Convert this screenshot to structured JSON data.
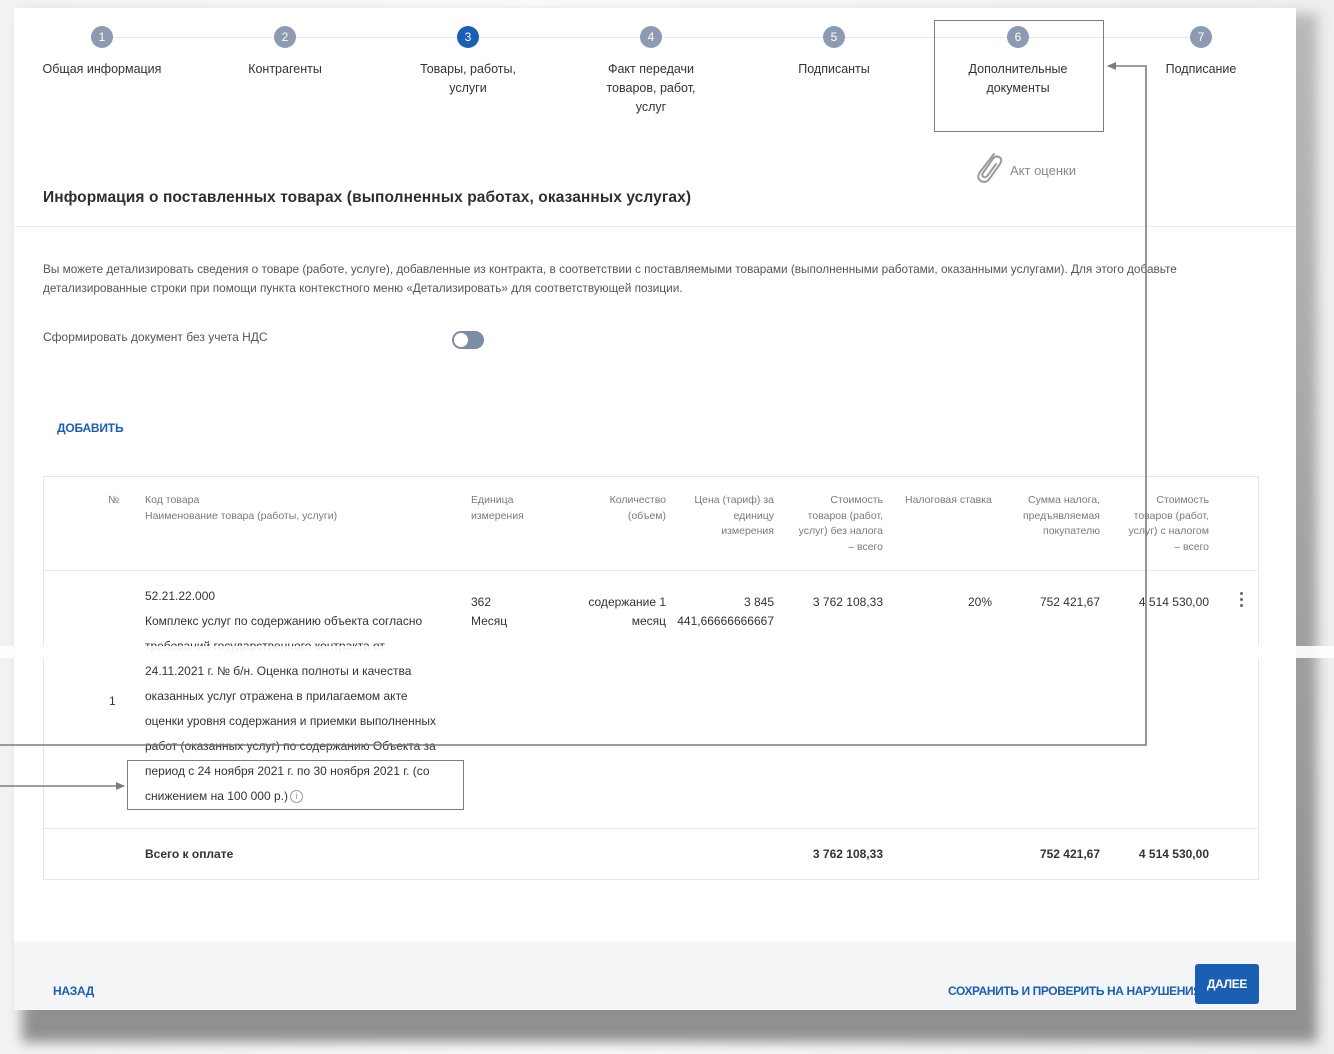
{
  "stepper": {
    "steps": [
      {
        "num": "1",
        "label": "Общая информация"
      },
      {
        "num": "2",
        "label": "Контрагенты"
      },
      {
        "num": "3",
        "label": "Товары, работы, услуги"
      },
      {
        "num": "4",
        "label": "Факт передачи товаров, работ, услуг"
      },
      {
        "num": "5",
        "label": "Подписанты"
      },
      {
        "num": "6",
        "label": "Дополнительные документы"
      },
      {
        "num": "7",
        "label": "Подписание"
      }
    ],
    "active_step": 3,
    "attachment": {
      "icon": "paperclip-icon",
      "label": "Акт оценки"
    }
  },
  "section": {
    "title": "Информация о поставленных товарах (выполненных работах, оказанных услугах)",
    "info": "Вы можете детализировать сведения о товаре (работе, услуге), добавленные из контракта, в соответствии с поставляемыми товарами (выполненными работами, оказанными услугами). Для этого добавьте детализированные строки при помощи пункта контекстного меню «Детализировать» для соответствующей позиции.",
    "vat_toggle_label": "Сформировать документ без учета НДС",
    "vat_toggle_on": false,
    "add_label": "ДОБАВИТЬ"
  },
  "table": {
    "headers": {
      "num": "№",
      "code_line1": "Код товара",
      "code_line2": "Наименование товара (работы, услуги)",
      "unit_line1": "Единица",
      "unit_line2": "измерения",
      "qty_line1": "Количество",
      "qty_line2": "(объем)",
      "price_line1": "Цена (тариф) за",
      "price_line2": "единицу",
      "price_line3": "измерения",
      "cost_line1": "Стоимость",
      "cost_line2": "товаров (работ,",
      "cost_line3": "услуг) без налога",
      "cost_line4": "– всего",
      "rate": "Налоговая ставка",
      "tax_line1": "Сумма налога,",
      "tax_line2": "предъявляемая",
      "tax_line3": "покупателю",
      "total_line1": "Стоимость",
      "total_line2": "товаров (работ,",
      "total_line3": "услуг) с налогом",
      "total_line4": "– всего"
    },
    "row": {
      "num": "1",
      "code": "52.21.22.000",
      "desc_1": "Комплекс услуг по содержанию объекта согласно",
      "desc_2": "требований государственного контракта от",
      "desc_3": "24.11.2021 г. № б/н. Оценка полноты и качества",
      "desc_4": "оказанных услуг отражена в прилагаемом акте",
      "desc_5": "оценки уровня содержания и приемки выполненных",
      "desc_6": "работ (оказанных услуг) по содержанию Объекта за",
      "desc_7": "период с 24 ноября 2021 г. по 30 ноября 2021 г. (со",
      "desc_8": "снижением на 100 000 р.)",
      "unit_code": "362",
      "unit_name": "Месяц",
      "qty_1": "содержание 1",
      "qty_2": "месяц",
      "price_1": "3 845",
      "price_2": "441,66666666667",
      "cost": "3 762 108,33",
      "rate": "20%",
      "tax": "752 421,67",
      "total": "4 514 530,00"
    },
    "totals": {
      "label": "Всего к оплате",
      "cost": "3 762 108,33",
      "tax": "752 421,67",
      "total": "4 514 530,00"
    }
  },
  "footer": {
    "back_label": "НАЗАД",
    "save_label": "СОХРАНИТЬ И ПРОВЕРИТЬ НА НАРУШЕНИЯ",
    "next_label": "ДАЛЕЕ"
  },
  "colors": {
    "accent": "#1a5fb4",
    "step_inactive": "#8d9bb2",
    "annotation": "#7c7c7c"
  }
}
